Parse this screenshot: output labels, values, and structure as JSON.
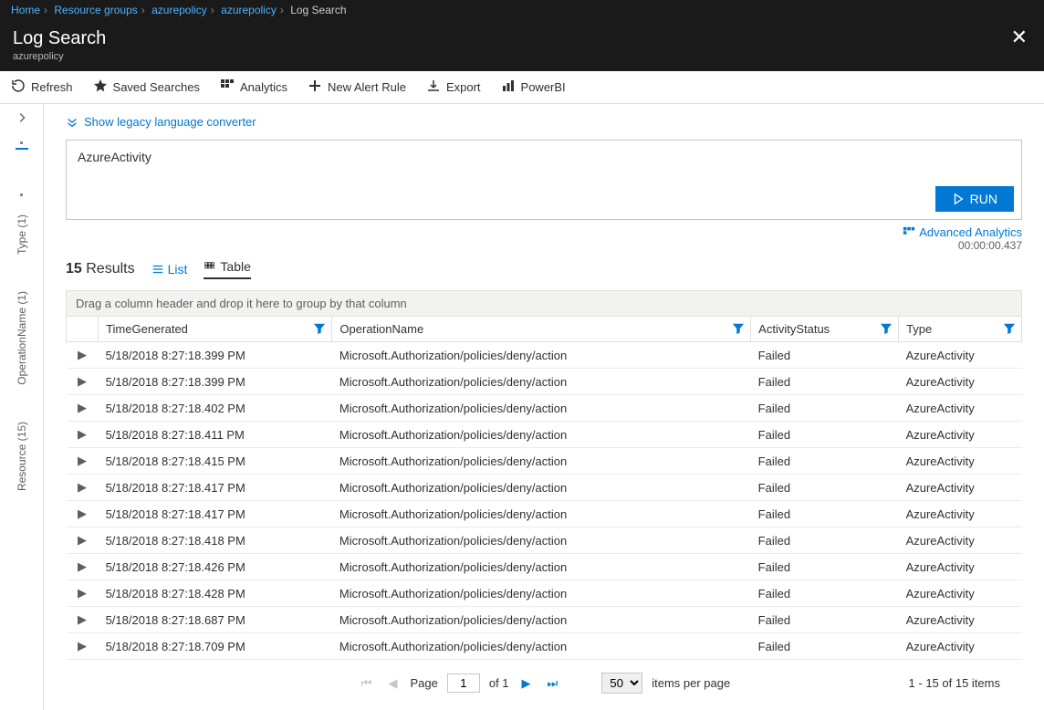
{
  "breadcrumb": {
    "items": [
      "Home",
      "Resource groups",
      "azurepolicy",
      "azurepolicy"
    ],
    "current": "Log Search"
  },
  "header": {
    "title": "Log Search",
    "subtitle": "azurepolicy"
  },
  "toolbar": {
    "refresh": "Refresh",
    "saved": "Saved Searches",
    "analytics": "Analytics",
    "newAlert": "New Alert Rule",
    "export": "Export",
    "powerbi": "PowerBI"
  },
  "rail": {
    "type": "Type (1)",
    "operation": "OperationName (1)",
    "resource": "Resource (15)"
  },
  "legacyLink": "Show legacy language converter",
  "query": "AzureActivity",
  "runLabel": "RUN",
  "advancedAnalytics": "Advanced Analytics",
  "timing": "00:00:00.437",
  "results": {
    "count": "15",
    "label": "Results",
    "listLabel": "List",
    "tableLabel": "Table"
  },
  "groupDrop": "Drag a column header and drop it here to group by that column",
  "columns": {
    "time": "TimeGenerated",
    "operation": "OperationName",
    "status": "ActivityStatus",
    "type": "Type"
  },
  "rows": [
    {
      "time": "5/18/2018 8:27:18.399 PM",
      "op": "Microsoft.Authorization/policies/deny/action",
      "status": "Failed",
      "type": "AzureActivity"
    },
    {
      "time": "5/18/2018 8:27:18.399 PM",
      "op": "Microsoft.Authorization/policies/deny/action",
      "status": "Failed",
      "type": "AzureActivity"
    },
    {
      "time": "5/18/2018 8:27:18.402 PM",
      "op": "Microsoft.Authorization/policies/deny/action",
      "status": "Failed",
      "type": "AzureActivity"
    },
    {
      "time": "5/18/2018 8:27:18.411 PM",
      "op": "Microsoft.Authorization/policies/deny/action",
      "status": "Failed",
      "type": "AzureActivity"
    },
    {
      "time": "5/18/2018 8:27:18.415 PM",
      "op": "Microsoft.Authorization/policies/deny/action",
      "status": "Failed",
      "type": "AzureActivity"
    },
    {
      "time": "5/18/2018 8:27:18.417 PM",
      "op": "Microsoft.Authorization/policies/deny/action",
      "status": "Failed",
      "type": "AzureActivity"
    },
    {
      "time": "5/18/2018 8:27:18.417 PM",
      "op": "Microsoft.Authorization/policies/deny/action",
      "status": "Failed",
      "type": "AzureActivity"
    },
    {
      "time": "5/18/2018 8:27:18.418 PM",
      "op": "Microsoft.Authorization/policies/deny/action",
      "status": "Failed",
      "type": "AzureActivity"
    },
    {
      "time": "5/18/2018 8:27:18.426 PM",
      "op": "Microsoft.Authorization/policies/deny/action",
      "status": "Failed",
      "type": "AzureActivity"
    },
    {
      "time": "5/18/2018 8:27:18.428 PM",
      "op": "Microsoft.Authorization/policies/deny/action",
      "status": "Failed",
      "type": "AzureActivity"
    },
    {
      "time": "5/18/2018 8:27:18.687 PM",
      "op": "Microsoft.Authorization/policies/deny/action",
      "status": "Failed",
      "type": "AzureActivity"
    },
    {
      "time": "5/18/2018 8:27:18.709 PM",
      "op": "Microsoft.Authorization/policies/deny/action",
      "status": "Failed",
      "type": "AzureActivity"
    }
  ],
  "pager": {
    "pageLabel": "Page",
    "page": "1",
    "ofLabel": "of 1",
    "perPage": "50",
    "perPageLabel": "items per page",
    "status": "1 - 15 of 15 items"
  }
}
